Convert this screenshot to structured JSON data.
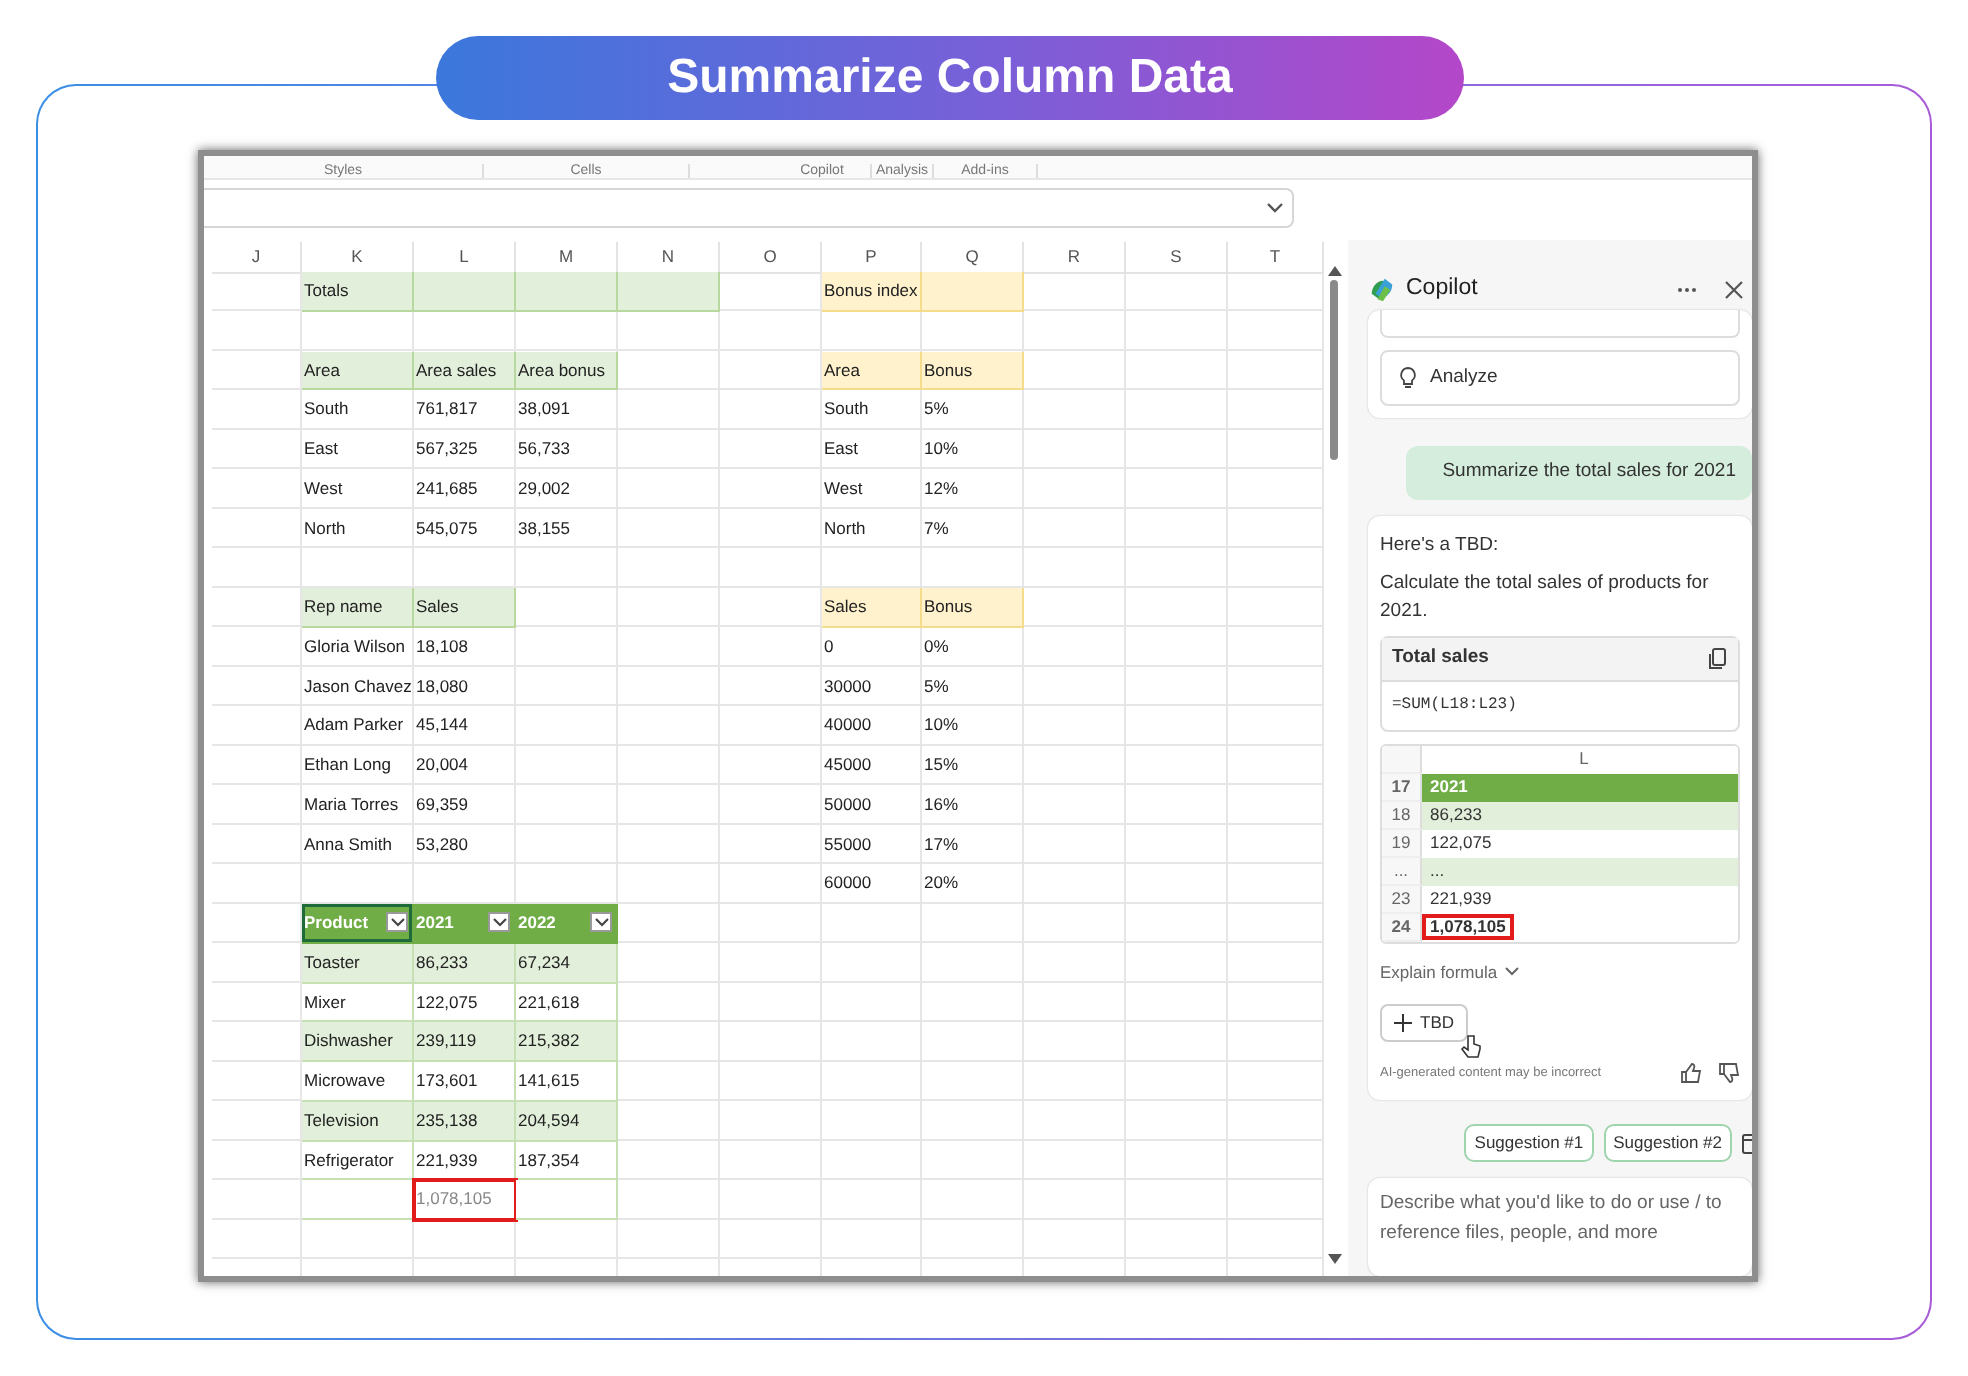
{
  "banner": {
    "title": "Summarize Column Data"
  },
  "ribbon": {
    "groups": [
      "Styles",
      "Cells",
      "Copilot",
      "Analysis",
      "Add-ins"
    ]
  },
  "sheet": {
    "columns": [
      "J",
      "K",
      "L",
      "M",
      "N",
      "O",
      "P",
      "Q",
      "R",
      "S",
      "T"
    ],
    "blocks": [
      [
        {
          "left": [
            {
              "text": "Totals",
              "kind": "green"
            },
            {
              "kind": "green"
            },
            {
              "kind": "green"
            },
            {
              "kind": "green"
            }
          ],
          "right": [
            {
              "text": "Bonus index",
              "kind": "yellow"
            },
            {
              "kind": "yellow"
            }
          ]
        }
      ],
      [
        {
          "left": [
            {
              "text": "Area",
              "kind": "green"
            },
            {
              "text": "Area sales",
              "kind": "green"
            },
            {
              "text": "Area bonus",
              "kind": "green"
            }
          ],
          "right": [
            {
              "text": "Area",
              "kind": "yellow"
            },
            {
              "text": "Bonus",
              "kind": "yellow"
            }
          ]
        },
        {
          "left": [
            {
              "text": "South",
              "kind": "plain"
            },
            {
              "text": "761,817",
              "kind": "plain"
            },
            {
              "text": "38,091",
              "kind": "plain"
            }
          ],
          "right": [
            {
              "text": "South",
              "kind": "plain"
            },
            {
              "text": "5%",
              "kind": "plain"
            }
          ]
        },
        {
          "left": [
            {
              "text": "East",
              "kind": "plain"
            },
            {
              "text": "567,325",
              "kind": "plain"
            },
            {
              "text": "56,733",
              "kind": "plain"
            }
          ],
          "right": [
            {
              "text": "East",
              "kind": "plain"
            },
            {
              "text": "10%",
              "kind": "plain"
            }
          ]
        },
        {
          "left": [
            {
              "text": "West",
              "kind": "plain"
            },
            {
              "text": "241,685",
              "kind": "plain"
            },
            {
              "text": "29,002",
              "kind": "plain"
            }
          ],
          "right": [
            {
              "text": "West",
              "kind": "plain"
            },
            {
              "text": "12%",
              "kind": "plain"
            }
          ]
        },
        {
          "left": [
            {
              "text": "North",
              "kind": "plain"
            },
            {
              "text": "545,075",
              "kind": "plain"
            },
            {
              "text": "38,155",
              "kind": "plain"
            }
          ],
          "right": [
            {
              "text": "North",
              "kind": "plain"
            },
            {
              "text": "7%",
              "kind": "plain"
            }
          ]
        }
      ],
      [
        {
          "left": [
            {
              "text": "Rep name",
              "kind": "green"
            },
            {
              "text": "Sales",
              "kind": "green"
            }
          ],
          "right": [
            {
              "text": "Sales",
              "kind": "yellow"
            },
            {
              "text": "Bonus",
              "kind": "yellow"
            }
          ]
        },
        {
          "left": [
            {
              "text": "Gloria Wilson",
              "kind": "plain"
            },
            {
              "text": "18,108",
              "kind": "plain"
            }
          ],
          "right": [
            {
              "text": "0",
              "kind": "plain"
            },
            {
              "text": "0%",
              "kind": "plain"
            }
          ]
        },
        {
          "left": [
            {
              "text": "Jason Chavez",
              "kind": "plain"
            },
            {
              "text": "18,080",
              "kind": "plain"
            }
          ],
          "right": [
            {
              "text": "30000",
              "kind": "plain"
            },
            {
              "text": "5%",
              "kind": "plain"
            }
          ]
        },
        {
          "left": [
            {
              "text": "Adam Parker",
              "kind": "plain"
            },
            {
              "text": "45,144",
              "kind": "plain"
            }
          ],
          "right": [
            {
              "text": "40000",
              "kind": "plain"
            },
            {
              "text": "10%",
              "kind": "plain"
            }
          ]
        },
        {
          "left": [
            {
              "text": "Ethan Long",
              "kind": "plain"
            },
            {
              "text": "20,004",
              "kind": "plain"
            }
          ],
          "right": [
            {
              "text": "45000",
              "kind": "plain"
            },
            {
              "text": "15%",
              "kind": "plain"
            }
          ]
        },
        {
          "left": [
            {
              "text": "Maria Torres",
              "kind": "plain"
            },
            {
              "text": "69,359",
              "kind": "plain"
            }
          ],
          "right": [
            {
              "text": "50000",
              "kind": "plain"
            },
            {
              "text": "16%",
              "kind": "plain"
            }
          ]
        },
        {
          "left": [
            {
              "text": "Anna Smith",
              "kind": "plain"
            },
            {
              "text": "53,280",
              "kind": "plain"
            }
          ],
          "right": [
            {
              "text": "55000",
              "kind": "plain"
            },
            {
              "text": "17%",
              "kind": "plain"
            }
          ]
        },
        {
          "right": [
            {
              "text": "60000",
              "kind": "plain"
            },
            {
              "text": "20%",
              "kind": "plain"
            }
          ]
        },
        {
          "left": [
            {
              "text": "Product",
              "kind": "thead",
              "selected": true
            },
            {
              "text": "2021",
              "kind": "thead",
              "selected": false
            },
            {
              "text": "2022",
              "kind": "thead",
              "selected": false
            }
          ]
        },
        {
          "left": [
            {
              "text": "Toaster",
              "kind": "band"
            },
            {
              "text": "86,233",
              "kind": "band"
            },
            {
              "text": "67,234",
              "kind": "band"
            }
          ]
        },
        {
          "left": [
            {
              "text": "Mixer",
              "kind": "tbody"
            },
            {
              "text": "122,075",
              "kind": "tbody"
            },
            {
              "text": "221,618",
              "kind": "tbody"
            }
          ]
        },
        {
          "left": [
            {
              "text": "Dishwasher",
              "kind": "band"
            },
            {
              "text": "239,119",
              "kind": "band"
            },
            {
              "text": "215,382",
              "kind": "band"
            }
          ]
        },
        {
          "left": [
            {
              "text": "Microwave",
              "kind": "tbody"
            },
            {
              "text": "173,601",
              "kind": "tbody"
            },
            {
              "text": "141,615",
              "kind": "tbody"
            }
          ]
        },
        {
          "left": [
            {
              "text": "Television",
              "kind": "band"
            },
            {
              "text": "235,138",
              "kind": "band"
            },
            {
              "text": "204,594",
              "kind": "band"
            }
          ]
        },
        {
          "left": [
            {
              "text": "Refrigerator",
              "kind": "tbody"
            },
            {
              "text": "221,939",
              "kind": "tbody"
            },
            {
              "text": "187,354",
              "kind": "tbody"
            }
          ]
        },
        {
          "left": [
            {
              "kind": "tbody"
            },
            {
              "text": "1,078,105",
              "kind": "total",
              "highlighted": true
            },
            {
              "kind": "tbody"
            }
          ]
        }
      ]
    ]
  },
  "copilot": {
    "title": "Copilot",
    "starter_buttons": [
      "Analyze"
    ],
    "user_message": "Summarize the total sales for 2021",
    "response": {
      "intro": "Here's a TBD:",
      "description": "Calculate the total sales of products for 2021.",
      "formula_card": {
        "title": "Total sales",
        "formula": "=SUM(L18:L23)"
      },
      "preview": {
        "column": "L",
        "rows": [
          {
            "number": "17",
            "value": "2021",
            "kind": "header",
            "highlighted": false
          },
          {
            "number": "18",
            "value": "86,233",
            "kind": "band",
            "highlighted": false
          },
          {
            "number": "19",
            "value": "122,075",
            "kind": "plain",
            "highlighted": false
          },
          {
            "number": "...",
            "value": "...",
            "kind": "band",
            "highlighted": false
          },
          {
            "number": "23",
            "value": "221,939",
            "kind": "plain",
            "highlighted": false
          },
          {
            "number": "24",
            "value": "1,078,105",
            "kind": "total",
            "highlighted": true
          }
        ]
      },
      "explain": "Explain formula",
      "action_button": "TBD",
      "disclaimer": "AI-generated content may be incorrect"
    },
    "suggestions": [
      "Suggestion #1",
      "Suggestion #2"
    ],
    "input": {
      "placeholder": "Describe what you'd like to do or use / to reference files, people, and more"
    }
  }
}
